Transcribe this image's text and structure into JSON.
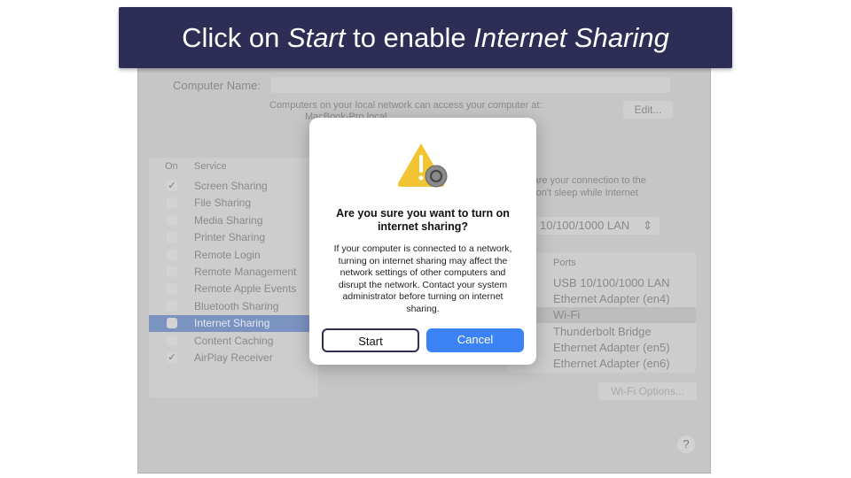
{
  "banner": {
    "prefix": "Click on ",
    "start": "Start",
    "middle": " to enable ",
    "feature": "Internet Sharing"
  },
  "window": {
    "computer_name_label": "Computer Name:",
    "access_note": "Computers on your local network can access your computer at:",
    "hostname": "MacBook-Pro.local",
    "edit_button": "Edit...",
    "services_header": {
      "on": "On",
      "service": "Service"
    },
    "services": [
      {
        "label": "Screen Sharing",
        "checked": true
      },
      {
        "label": "File Sharing",
        "checked": false
      },
      {
        "label": "Media Sharing",
        "checked": false
      },
      {
        "label": "Printer Sharing",
        "checked": false
      },
      {
        "label": "Remote Login",
        "checked": false
      },
      {
        "label": "Remote Management",
        "checked": false
      },
      {
        "label": "Remote Apple Events",
        "checked": false
      },
      {
        "label": "Bluetooth Sharing",
        "checked": false
      },
      {
        "label": "Internet Sharing",
        "checked": false,
        "selected": true
      },
      {
        "label": "Content Caching",
        "checked": false
      },
      {
        "label": "AirPlay Receiver",
        "checked": true
      }
    ],
    "desc_line1": "share your connection to the",
    "desc_line2": "r won't sleep while Internet",
    "share_from_value": "10/100/1000 LAN",
    "ports_header": "Ports",
    "ports": [
      "USB 10/100/1000 LAN",
      "Ethernet Adapter (en4)",
      "Wi-Fi",
      "Thunderbolt Bridge",
      "Ethernet Adapter (en5)",
      "Ethernet Adapter (en6)"
    ],
    "wifi_options_button": "Wi-Fi Options...",
    "help_button": "?"
  },
  "dialog": {
    "title": "Are you sure you want to turn on internet sharing?",
    "message": "If your computer is connected to a network, turning on internet sharing may affect the network settings of other computers and disrupt the network. Contact your system administrator before turning on internet sharing.",
    "start_button": "Start",
    "cancel_button": "Cancel",
    "accent": "#3b82f6"
  }
}
